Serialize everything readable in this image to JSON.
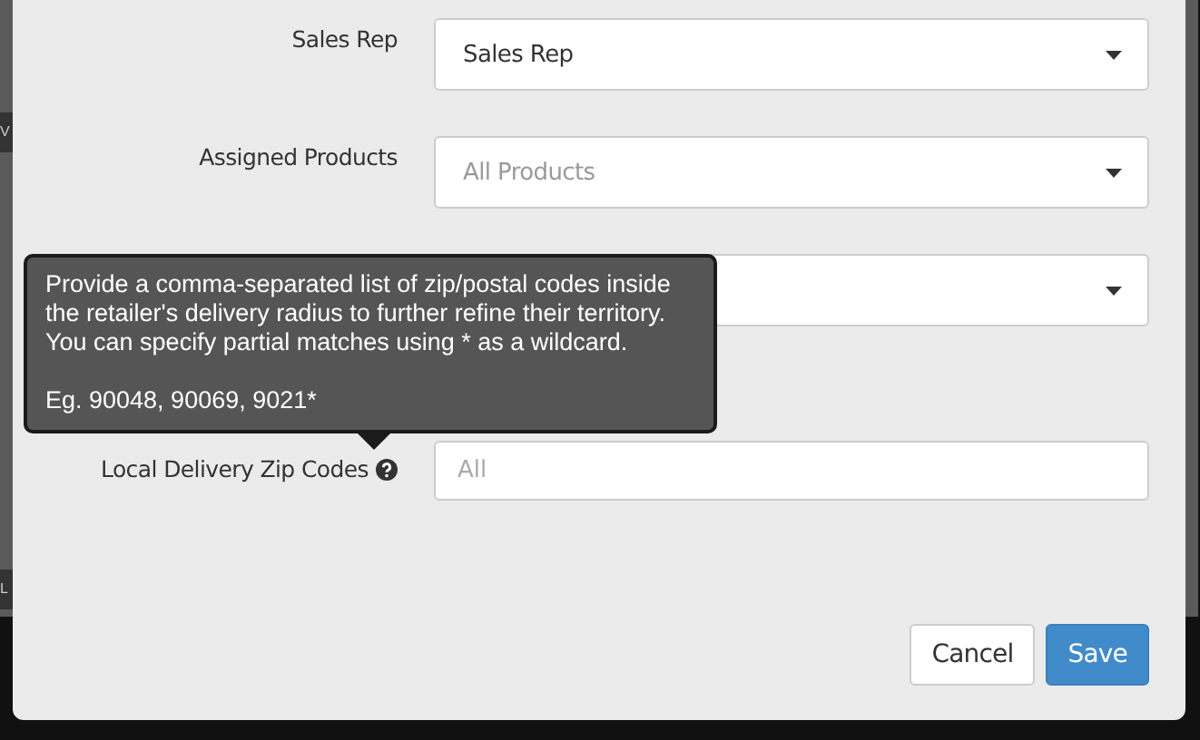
{
  "backdrop": {
    "fragments": [
      "V",
      "L"
    ]
  },
  "form": {
    "fields": [
      {
        "kind": "select",
        "label": "Sales Rep",
        "value": "Sales Rep"
      },
      {
        "kind": "select",
        "label": "Assigned Products",
        "placeholder": "All Products"
      },
      {
        "kind": "select"
      },
      {
        "kind": "text",
        "label": "Local Delivery Zip Codes",
        "help": true,
        "placeholder": "All"
      }
    ]
  },
  "tooltip": {
    "text": "Provide a comma-separated list of zip/postal codes inside the retailer's delivery radius to further refine their territory. You can specify partial matches using * as a wildcard.",
    "example": "Eg. 90048, 90069, 9021*"
  },
  "buttons": [
    {
      "kind": "secondary",
      "label": "Cancel"
    },
    {
      "kind": "primary",
      "label": "Save"
    }
  ]
}
